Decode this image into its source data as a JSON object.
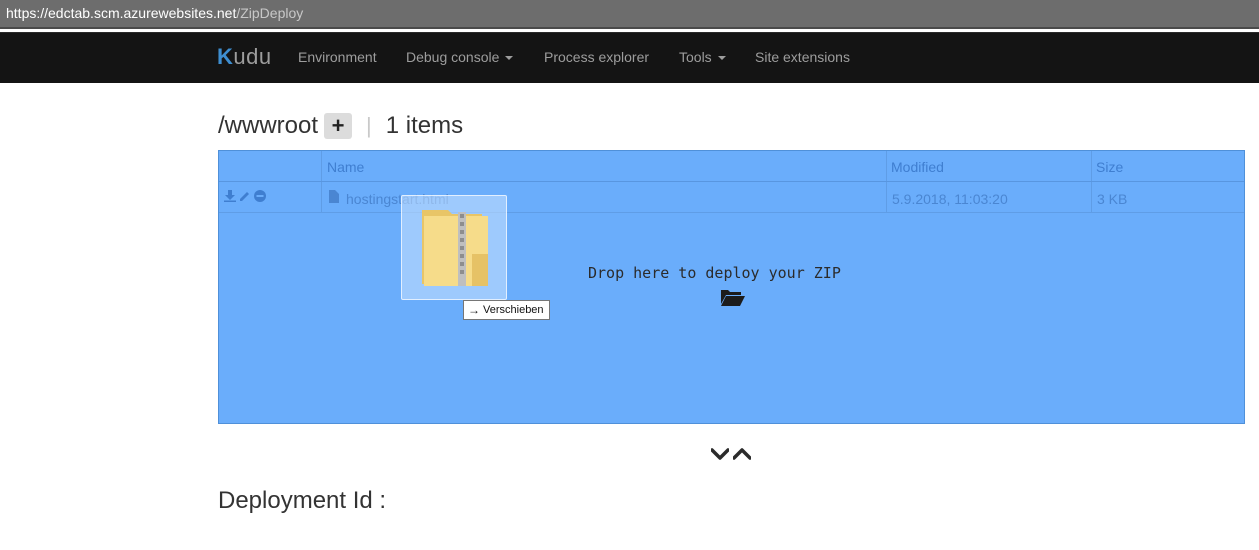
{
  "browser": {
    "url_host": "https://edctab.scm.azurewebsites.net",
    "url_path": "/ZipDeploy"
  },
  "navbar": {
    "brand_rest": "udu",
    "items": [
      {
        "label": "Environment",
        "dropdown": false
      },
      {
        "label": "Debug console",
        "dropdown": true
      },
      {
        "label": "Process explorer",
        "dropdown": false
      },
      {
        "label": "Tools",
        "dropdown": true
      },
      {
        "label": "Site extensions",
        "dropdown": false
      }
    ]
  },
  "path_header": {
    "path": "/wwwroot",
    "add_label": "+",
    "separator": "|",
    "item_count": "1 items"
  },
  "table": {
    "columns": [
      "Name",
      "Modified",
      "Size"
    ],
    "rows": [
      {
        "name": "hostingstart.html",
        "modified": "5.9.2018, 11:03:20",
        "size": "3 KB"
      }
    ]
  },
  "dropzone": {
    "message": "Drop here to deploy your ZIP",
    "icon": "folder-open-icon"
  },
  "drag": {
    "tooltip": "Verschieben",
    "item_icon": "zip-folder-icon"
  },
  "deployment": {
    "label": "Deployment Id :"
  },
  "colors": {
    "navbar_bg": "#141414",
    "dropzone_bg": "#6aadfb",
    "brand_accent": "#3e8ed0"
  }
}
